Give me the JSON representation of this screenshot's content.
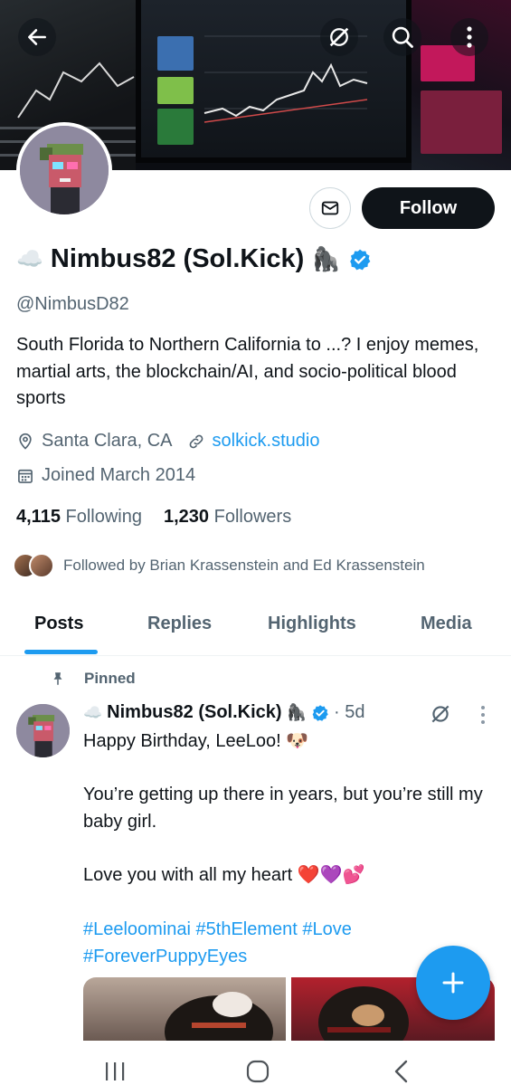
{
  "profile": {
    "display_name": "Nimbus82 (Sol.Kick)",
    "name_prefix_emoji": "☁️",
    "name_suffix_emoji": "🦍",
    "handle": "@NimbusD82",
    "bio": "South Florida to Northern California to ...? I enjoy memes, martial arts, the blockchain/AI, and socio-political blood sports",
    "location": "Santa Clara, CA",
    "website": "solkick.studio",
    "joined": "Joined March 2014",
    "following_count": "4,115",
    "following_label": "Following",
    "followers_count": "1,230",
    "followers_label": "Followers",
    "followed_by": "Followed by Brian Krassenstein and Ed Krassenstein",
    "verified": true
  },
  "actions": {
    "follow_label": "Follow"
  },
  "tabs": [
    {
      "label": "Posts",
      "active": true
    },
    {
      "label": "Replies",
      "active": false
    },
    {
      "label": "Highlights",
      "active": false
    },
    {
      "label": "Media",
      "active": false
    }
  ],
  "post": {
    "pinned_label": "Pinned",
    "author_name": "Nimbus82 (Sol.Kick)",
    "author_prefix_emoji": "☁️",
    "author_suffix_emoji": "🦍",
    "time": "· 5d",
    "body": "Happy Birthday, LeeLoo! 🐶\n\nYou’re getting up there in years, but you’re still my baby girl.\n\nLove you with all my heart ❤️💜💕",
    "hashtags_line1": "#Leeloominai #5thElement #Love",
    "hashtags_line2": "#ForeverPuppyEyes"
  },
  "colors": {
    "accent": "#1d9bf0",
    "text_primary": "#0f1419",
    "text_secondary": "#536471"
  }
}
